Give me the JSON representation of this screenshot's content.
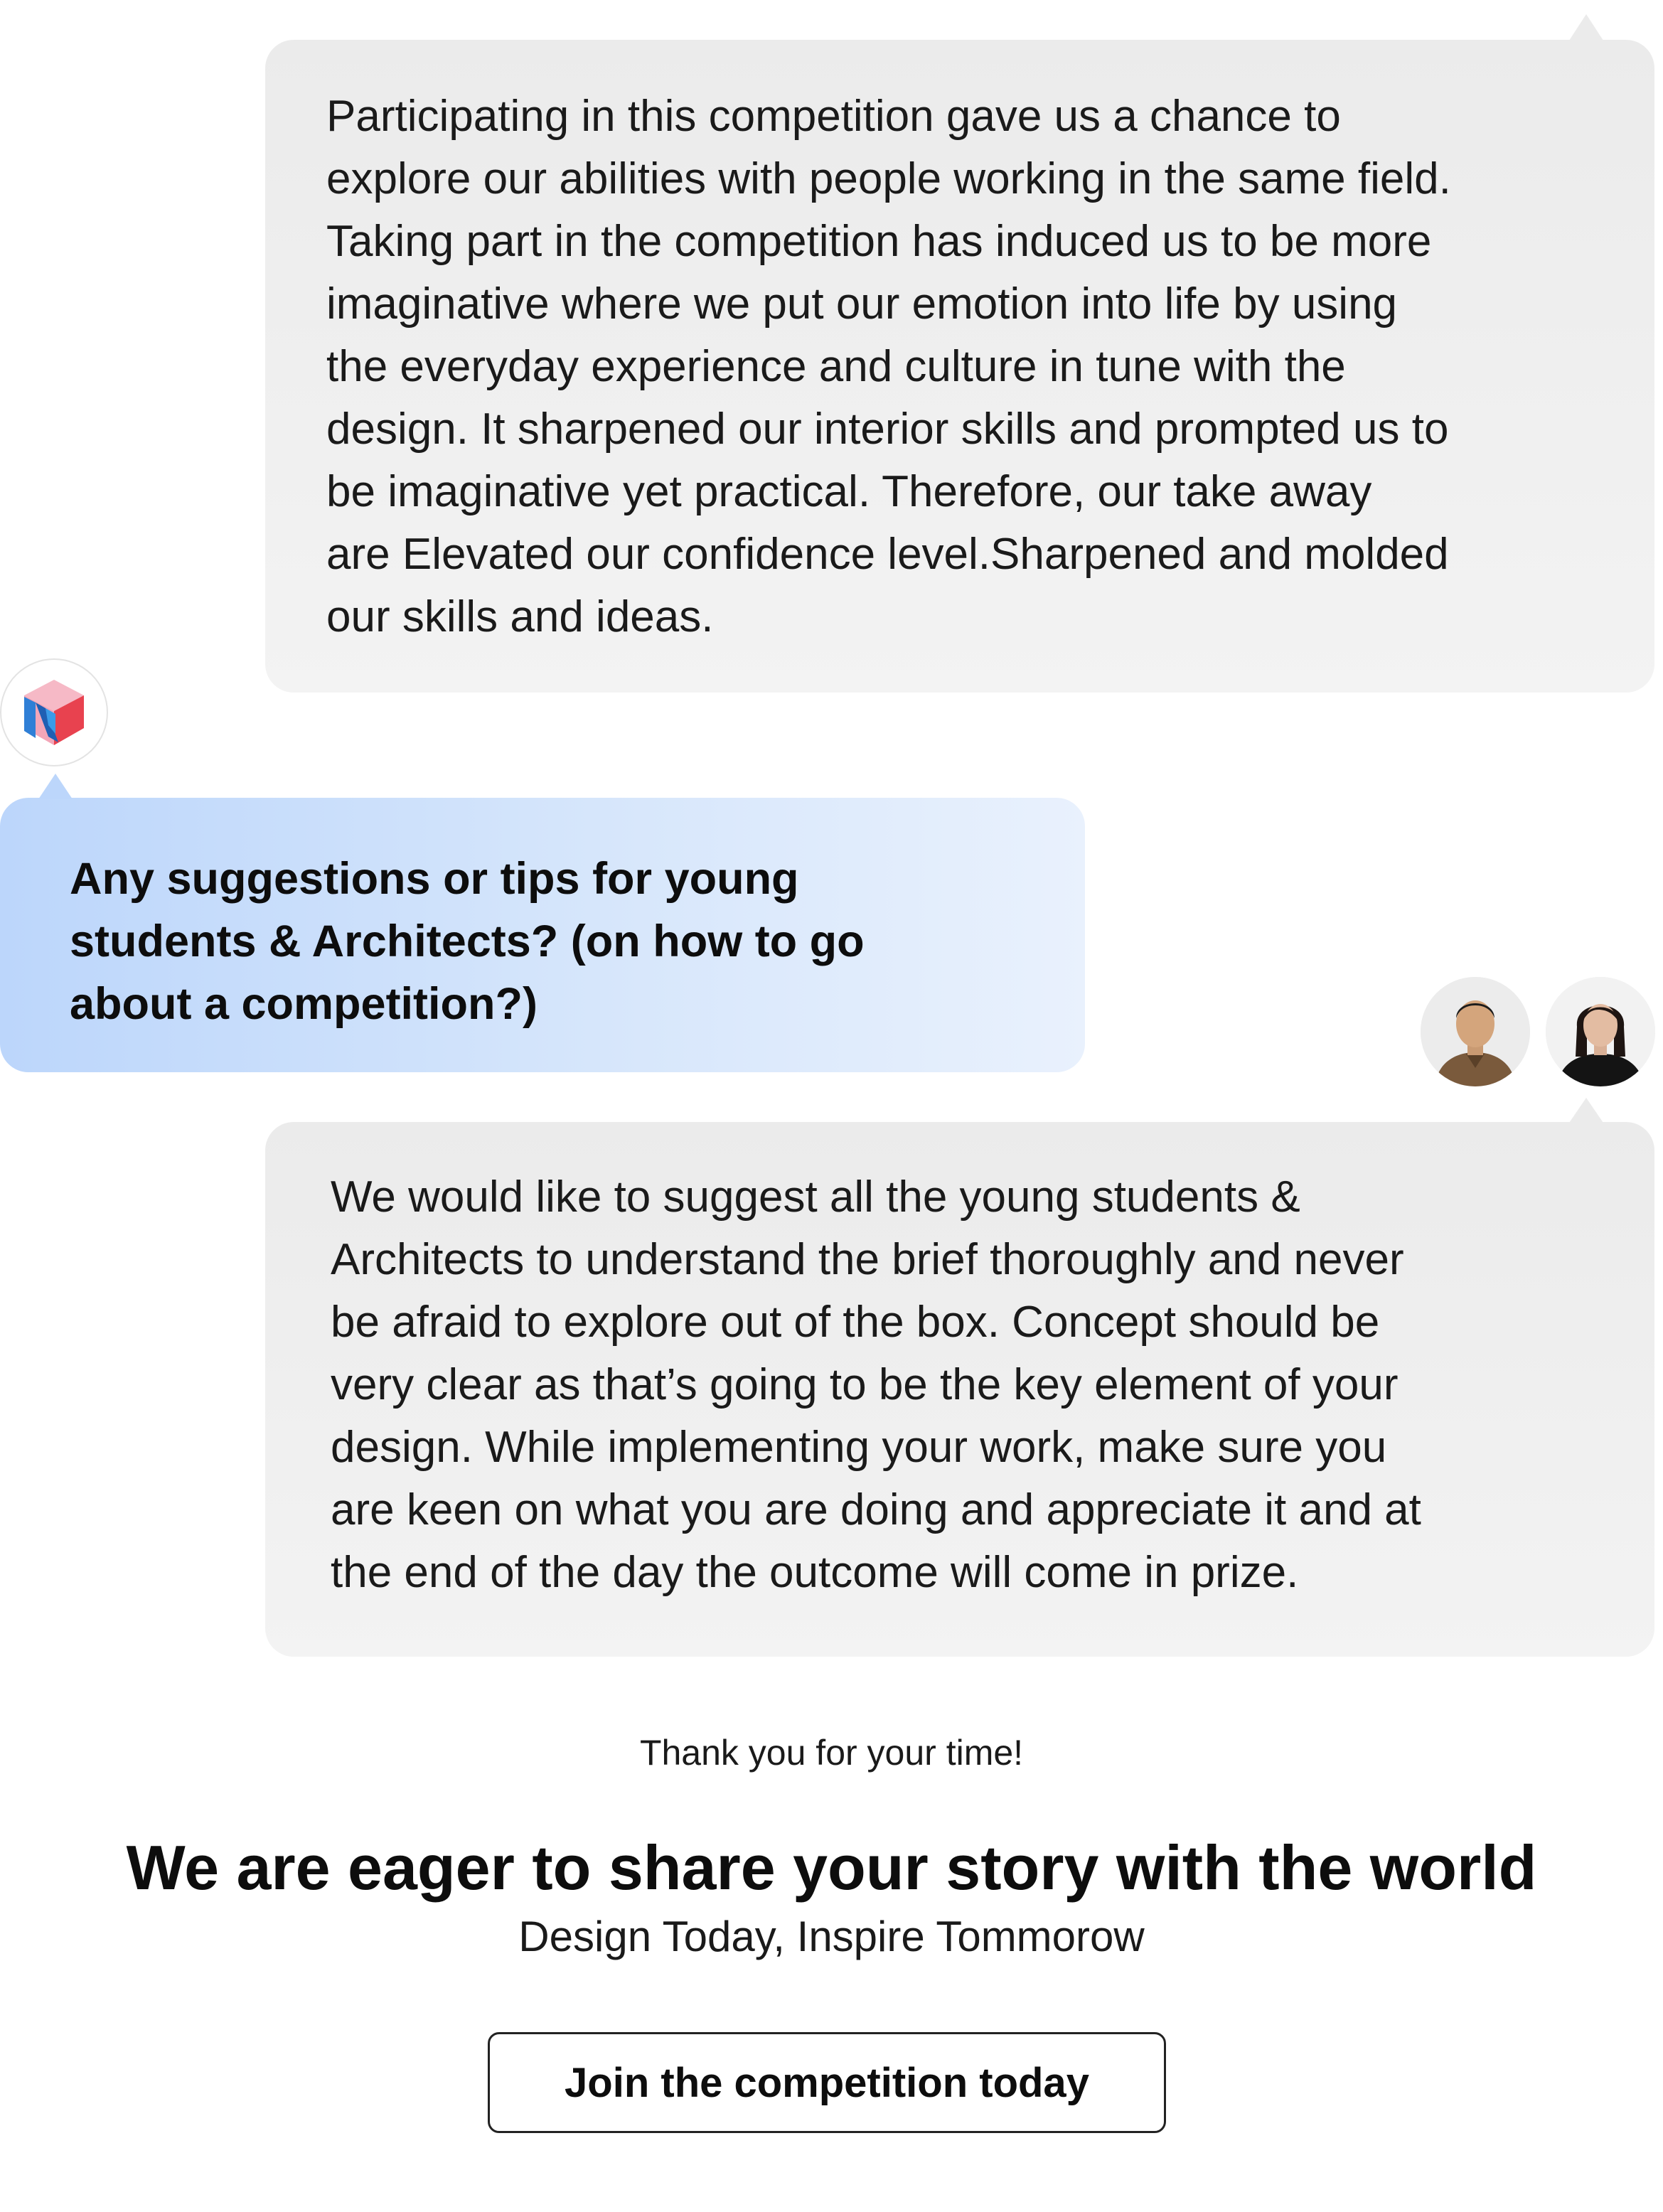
{
  "conversation": {
    "answer_1": "Participating in this competition gave us a chance to\nexplore our abilities with people working in the same field.\nTaking part in the competition has induced us to be more\nimaginative where we put our emotion into life by using\nthe everyday experience and culture in tune with the\ndesign. It sharpened our interior skills and prompted us to\nbe imaginative yet practical. Therefore, our take away\nare Elevated our confidence level.Sharpened and molded\nour skills and ideas.",
    "question": "Any suggestions or tips for young\nstudents & Architects? (on how to go\nabout a competition?)",
    "answer_2": "We would like to suggest all the young students &\nArchitects to understand the brief thoroughly and never\nbe afraid to explore out of the box. Concept should be\nvery clear as that’s going to be the key element of your\ndesign. While implementing your work, make sure you\nare keen on what you are doing and appreciate it and at\nthe end of the day the outcome will come in prize."
  },
  "footer": {
    "thanks": "Thank you for your time!",
    "heading": "We are eager to share your story with the world",
    "subheading": "Design Today, Inspire Tommorow",
    "button_label": "Join the competition today"
  },
  "icons": {
    "logo": "brand-logo-icon",
    "avatar_1": "person-avatar-male",
    "avatar_2": "person-avatar-female"
  },
  "colors": {
    "question_bubble_start": "#bcd6fb",
    "question_bubble_end": "#e9f1fd",
    "answer_bubble": "#ebebeb",
    "logo_blue": "#2f7fd6",
    "logo_pink": "#f3a6b8",
    "logo_red": "#e8424f"
  }
}
